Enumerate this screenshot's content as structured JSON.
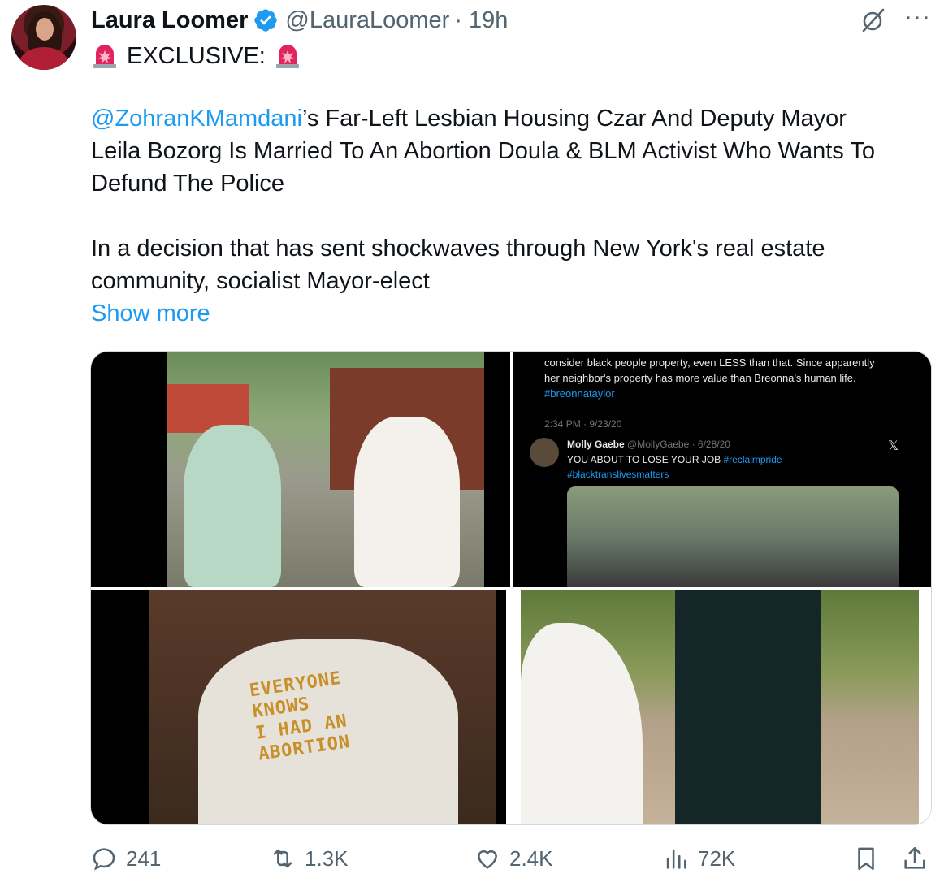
{
  "tweet": {
    "author_name": "Laura Loomer",
    "author_handle": "@LauraLoomer",
    "time": "· 19h",
    "headline": "EXCLUSIVE:",
    "mention": "@ZohranKMamdani",
    "line1_rest": "’s Far-Left Lesbian Housing Czar And Deputy Mayor",
    "line2": "Leila Bozorg Is Married To An Abortion Doula & BLM Activist Who Wants To",
    "line3": "Defund The Police",
    "line4": "In a decision that has sent shockwaves through New York's real estate",
    "line5": "community, socialist Mayor-elect",
    "show_more": "Show more"
  },
  "embedded": {
    "text1": "consider black people property, even LESS than that. Since apparently",
    "text2": "her neighbor's property has more value than Breonna's human life.",
    "hashtag": "#breonnataylor",
    "timestamp": "2:34 PM · 9/23/20",
    "quoted_name": "Molly Gaebe",
    "quoted_handle": "@MollyGaebe · 6/28/20",
    "quoted_text": "YOU ABOUT TO LOSE YOUR JOB",
    "quoted_tag1": "#reclaimpride",
    "quoted_tag2": "#blacktranslivesmatters",
    "x_logo": "𝕏"
  },
  "shirt": {
    "line1": "EVERYONE",
    "line2": "KNOWS",
    "line3": "I HAD AN",
    "line4": "ABORTION"
  },
  "actions": {
    "replies": "241",
    "reposts": "1.3K",
    "likes": "2.4K",
    "views": "72K"
  },
  "colors": {
    "link": "#1d9bf0",
    "muted": "#536471",
    "verified": "#1d9bf0",
    "siren": "#e0245e"
  },
  "icons": [
    "verified-badge-icon",
    "grok-icon",
    "more-icon",
    "siren-icon",
    "reply-icon",
    "repost-icon",
    "like-icon",
    "views-icon",
    "bookmark-icon",
    "share-icon"
  ]
}
